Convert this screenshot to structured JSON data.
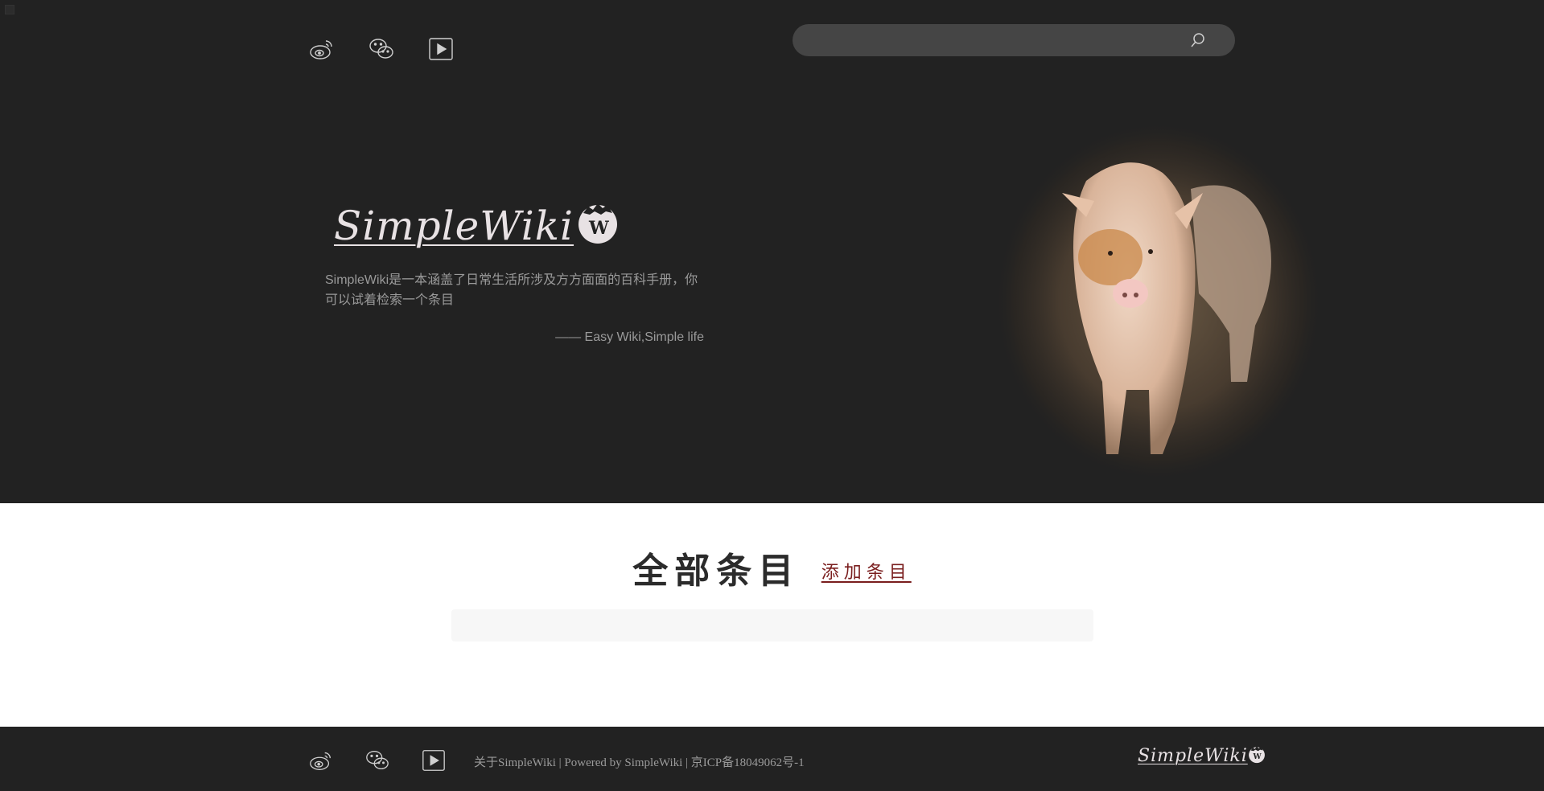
{
  "header": {
    "social_icons": [
      "weibo-icon",
      "wechat-icon",
      "video-icon"
    ],
    "search": {
      "placeholder": "",
      "value": ""
    }
  },
  "hero": {
    "logo_text": "SimpleWiki",
    "logo_badge": "W",
    "description": "SimpleWiki是一本涵盖了日常生活所涉及方方面面的百科手册，你可以试着检索一个条目",
    "tagline": "—— Easy Wiki,Simple life"
  },
  "main": {
    "title": "全部条目",
    "add_link": "添加条目"
  },
  "footer": {
    "social_icons": [
      "weibo-icon",
      "wechat-icon",
      "video-icon"
    ],
    "text": "关于SimpleWiki | Powered by SimpleWiki | 京ICP备18049062号-1",
    "logo_text": "SimpleWiki"
  },
  "colors": {
    "background_dark": "#222222",
    "search_bg": "#454545",
    "text_muted": "#9a9a9a",
    "link_accent": "#7a1e1e"
  }
}
